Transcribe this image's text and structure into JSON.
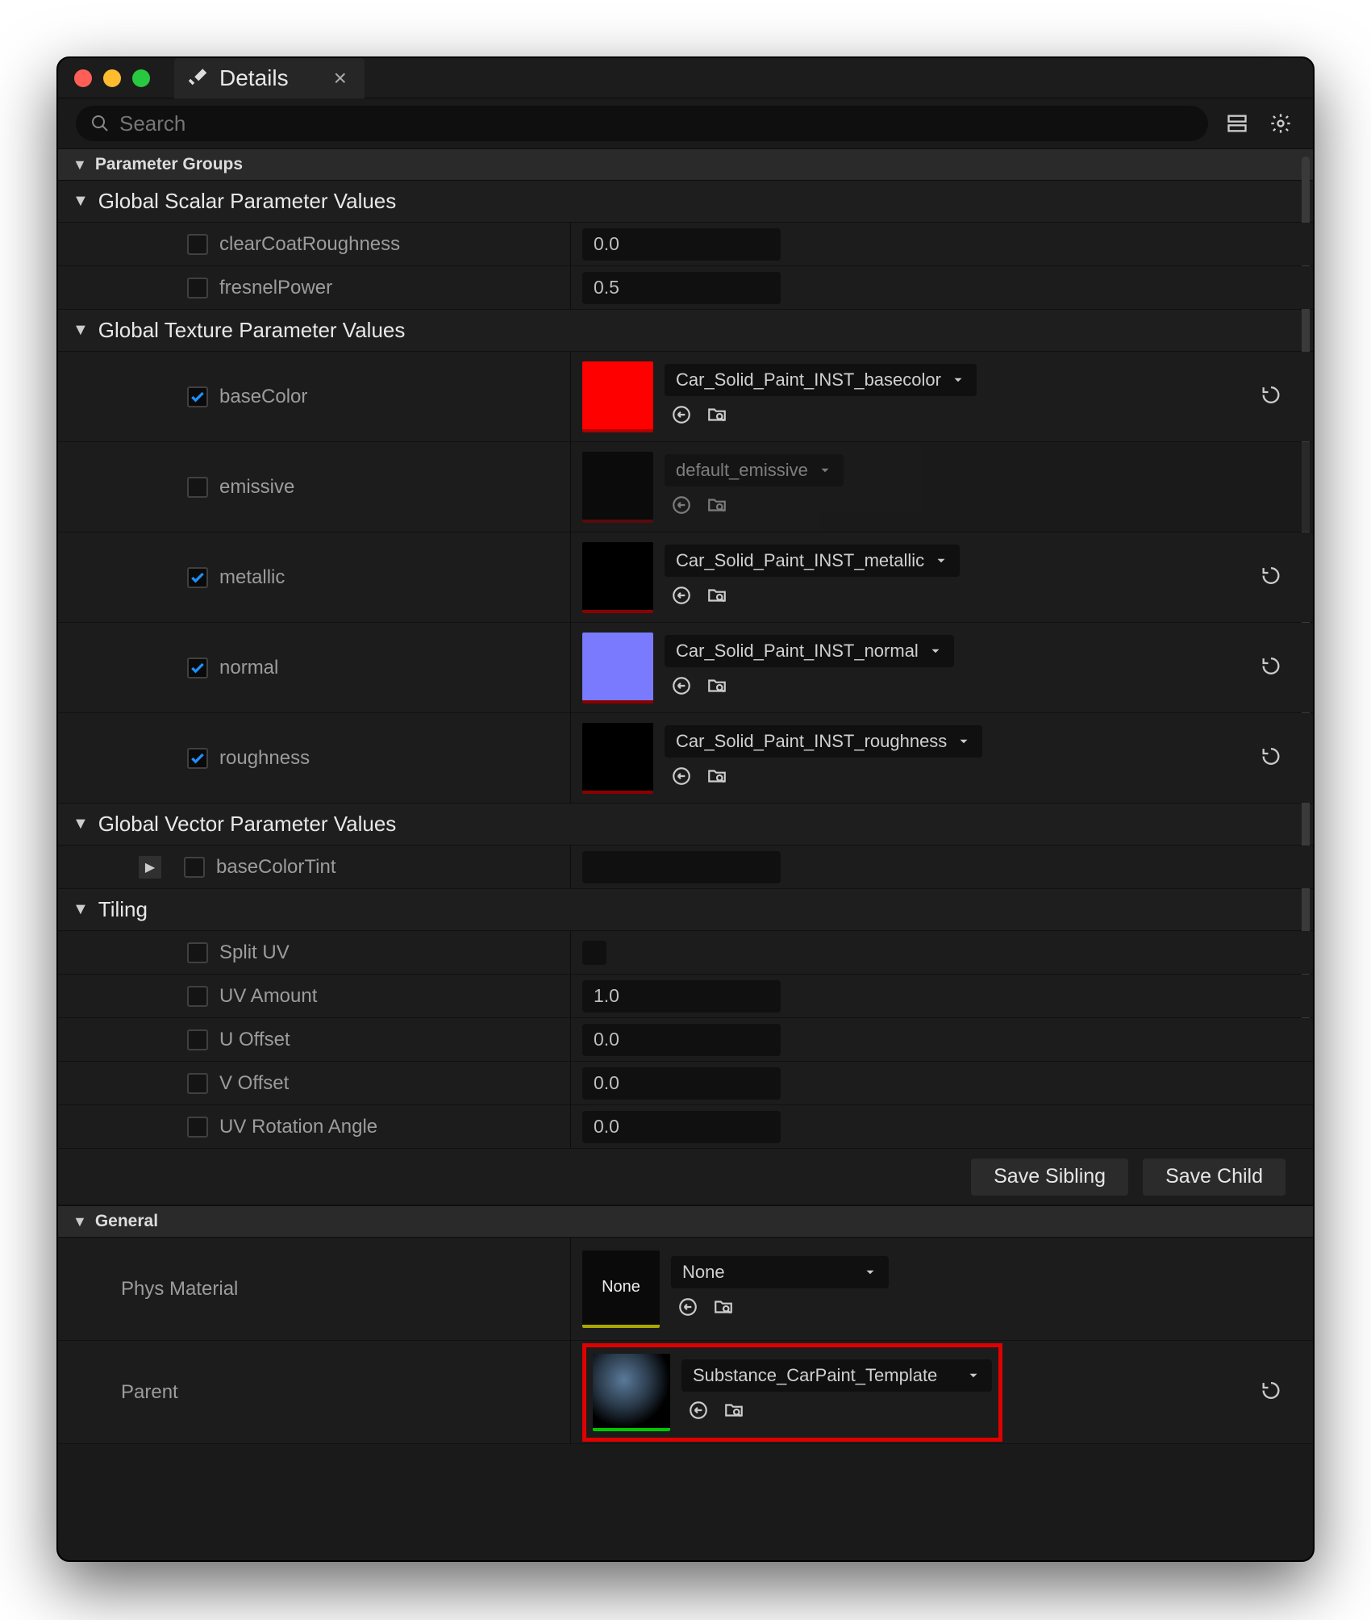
{
  "tab": {
    "title": "Details"
  },
  "search": {
    "placeholder": "Search"
  },
  "sections": {
    "paramGroups": "Parameter Groups",
    "general": "General"
  },
  "groups": {
    "scalar": "Global Scalar Parameter Values",
    "texture": "Global Texture Parameter Values",
    "vector": "Global Vector Parameter Values",
    "tiling": "Tiling"
  },
  "scalar": {
    "clearCoatRoughness": {
      "label": "clearCoatRoughness",
      "value": "0.0"
    },
    "fresnelPower": {
      "label": "fresnelPower",
      "value": "0.5"
    }
  },
  "texture": {
    "baseColor": {
      "label": "baseColor",
      "asset": "Car_Solid_Paint_INST_basecolor"
    },
    "emissive": {
      "label": "emissive",
      "asset": "default_emissive"
    },
    "metallic": {
      "label": "metallic",
      "asset": "Car_Solid_Paint_INST_metallic"
    },
    "normal": {
      "label": "normal",
      "asset": "Car_Solid_Paint_INST_normal"
    },
    "roughness": {
      "label": "roughness",
      "asset": "Car_Solid_Paint_INST_roughness"
    }
  },
  "vector": {
    "baseColorTint": {
      "label": "baseColorTint"
    }
  },
  "tiling": {
    "splitUV": {
      "label": "Split UV"
    },
    "uvAmount": {
      "label": "UV Amount",
      "value": "1.0"
    },
    "uOffset": {
      "label": "U Offset",
      "value": "0.0"
    },
    "vOffset": {
      "label": "V Offset",
      "value": "0.0"
    },
    "uvRot": {
      "label": "UV Rotation Angle",
      "value": "0.0"
    }
  },
  "buttons": {
    "saveSibling": "Save Sibling",
    "saveChild": "Save Child"
  },
  "general": {
    "physMaterial": {
      "label": "Phys Material",
      "asset": "None",
      "thumb": "None"
    },
    "parent": {
      "label": "Parent",
      "asset": "Substance_CarPaint_Template"
    }
  }
}
